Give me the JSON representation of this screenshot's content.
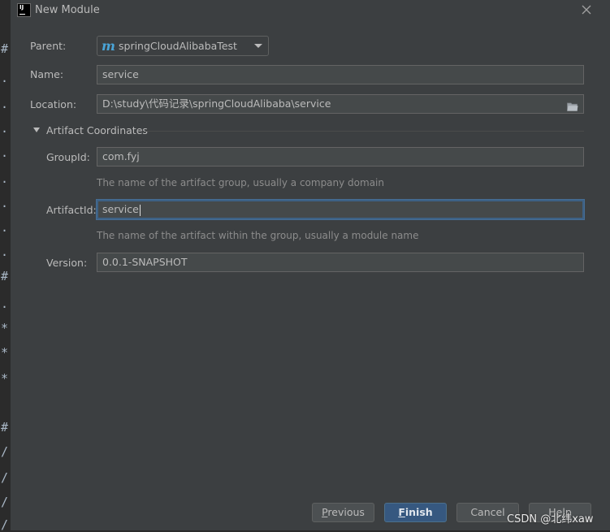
{
  "dialog": {
    "title": "New Module",
    "app_icon_text": "IJ"
  },
  "editor_gutter": {
    "glyphs": [
      "#",
      ".",
      ".",
      ".",
      ".",
      ".",
      ".",
      ".",
      ".",
      "#",
      ".",
      "*",
      "*",
      "*",
      "#",
      "/",
      "/",
      "/",
      "/"
    ]
  },
  "form": {
    "parent": {
      "label": "Parent:",
      "value": "springCloudAlibabaTest",
      "icon": "maven-m-icon"
    },
    "name": {
      "label": "Name:",
      "value": "service"
    },
    "location": {
      "label": "Location:",
      "value": "D:\\study\\代码记录\\springCloudAlibaba\\service",
      "icon": "folder-open-icon"
    }
  },
  "artifact_section": {
    "title": "Artifact Coordinates",
    "expanded": true,
    "group_id": {
      "label": "GroupId:",
      "value": "com.fyj",
      "hint": "The name of the artifact group, usually a company domain"
    },
    "artifact_id": {
      "label": "ArtifactId:",
      "value": "service",
      "hint": "The name of the artifact within the group, usually a module name"
    },
    "version": {
      "label": "Version:",
      "value": "0.0.1-SNAPSHOT"
    }
  },
  "buttons": {
    "previous_mnemonic": "P",
    "previous_rest": "revious",
    "finish_mnemonic": "F",
    "finish_rest": "inish",
    "cancel": "Cancel",
    "help": "Help"
  },
  "watermark": "CSDN @北纬xaw",
  "colors": {
    "dialog_bg": "#3c3f41",
    "field_bg": "#45494a",
    "focus_border": "#3d6185",
    "primary_button": "#365880",
    "maven_icon": "#4aa5d8"
  }
}
